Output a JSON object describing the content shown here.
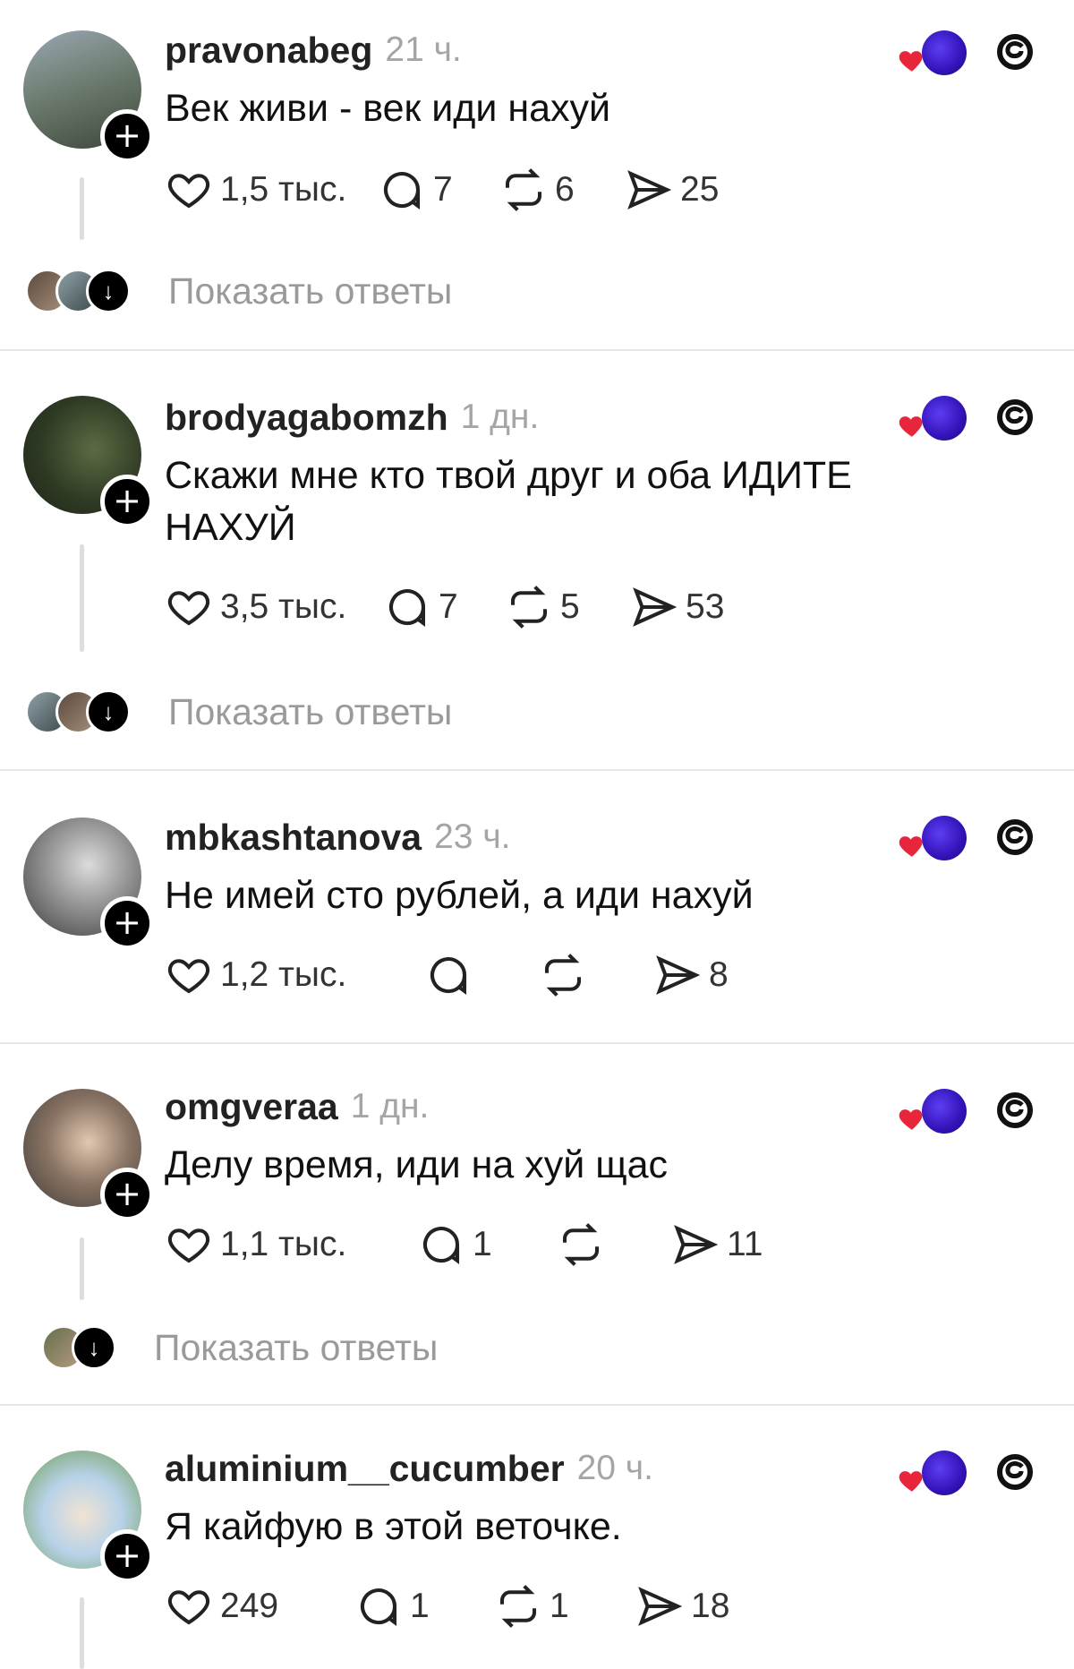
{
  "posts": [
    {
      "username": "pravonabeg",
      "time": "21 ч.",
      "text": "Век живи - век иди нахуй",
      "likes": "1,5 тыс.",
      "comments": "7",
      "reposts": "6",
      "shares": "25",
      "show_replies": "Показать ответы"
    },
    {
      "username": "brodyagabomzh",
      "time": "1 дн.",
      "text": "Скажи мне кто твой друг и оба ИДИТЕ НАХУЙ",
      "likes": "3,5 тыс.",
      "comments": "7",
      "reposts": "5",
      "shares": "53",
      "show_replies": "Показать ответы"
    },
    {
      "username": "mbkashtanova",
      "time": "23 ч.",
      "text": "Не имей сто рублей, а иди нахуй",
      "likes": "1,2 тыс.",
      "comments": "",
      "reposts": "",
      "shares": "8",
      "show_replies": ""
    },
    {
      "username": "omgveraa",
      "time": "1 дн.",
      "text": "Делу время, иди на хуй щас",
      "likes": "1,1 тыс.",
      "comments": "1",
      "reposts": "",
      "shares": "11",
      "show_replies": "Показать ответы"
    },
    {
      "username": "aluminium__cucumber",
      "time": "20 ч.",
      "text": "Я кайфую в этой веточке.",
      "likes": "249",
      "comments": "1",
      "reposts": "1",
      "shares": "18",
      "show_replies": ""
    }
  ],
  "icons": {
    "like": "heart-outline-icon",
    "comment": "speech-bubble-icon",
    "repost": "repost-arrows-icon",
    "share": "send-arrow-icon",
    "corner_app": "threads-logo-icon",
    "corner_badge": "heart-blob-icon",
    "follow": "plus-icon",
    "expand": "arrow-down-icon"
  },
  "colors": {
    "heart_red": "#e8263b",
    "blob_purple": "#3a17c9",
    "muted_text": "#9a9a9a"
  }
}
